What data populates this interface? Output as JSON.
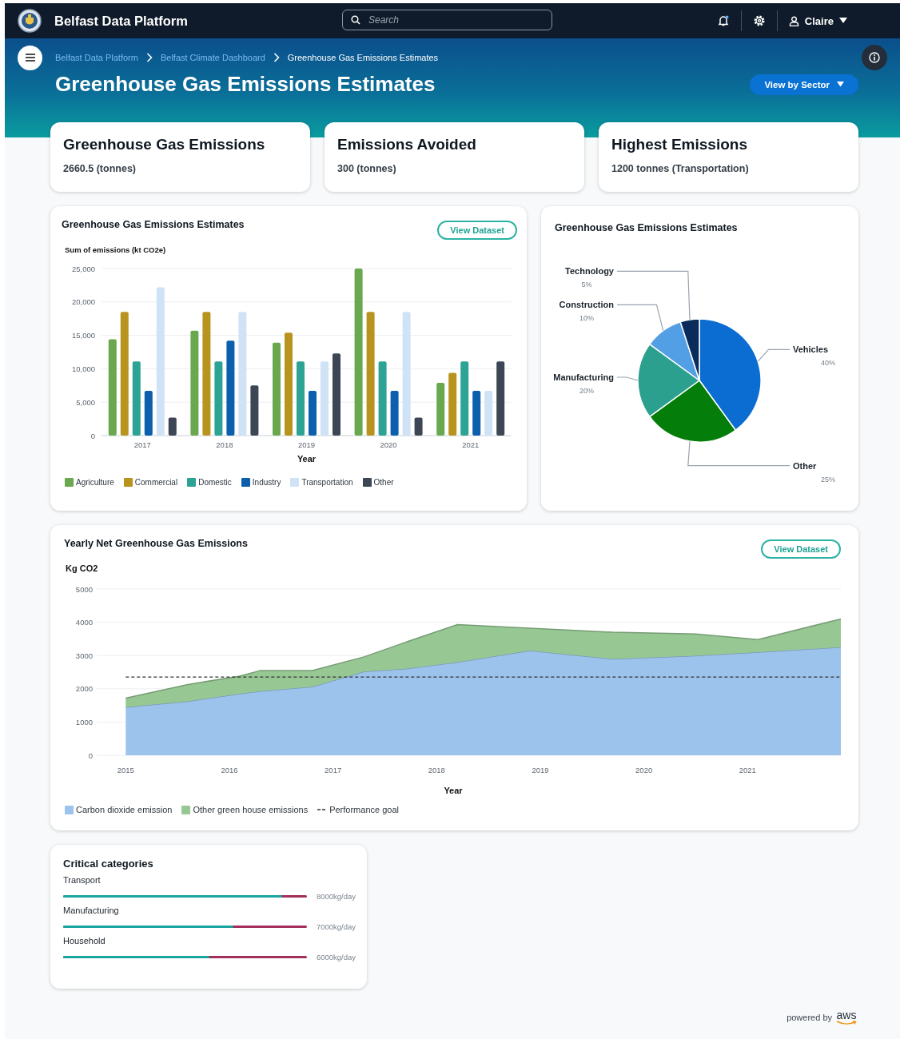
{
  "navbar": {
    "title": "Belfast Data Platform",
    "search": {
      "placeholder": "Search"
    },
    "user": "Claire"
  },
  "breadcrumbs": [
    {
      "label": "Belfast Data Platform",
      "current": false
    },
    {
      "label": "Belfast Climate Dashboard",
      "current": false
    },
    {
      "label": "Greenhouse Gas Emissions Estimates",
      "current": true
    }
  ],
  "page_title": "Greenhouse Gas Emissions Estimates",
  "view_button": "View by Sector",
  "summary_cards": [
    {
      "title": "Greenhouse Gas Emissions",
      "value": "2660.5 (tonnes)"
    },
    {
      "title": "Emissions Avoided",
      "value": "300 (tonnes)"
    },
    {
      "title": "Highest Emissions",
      "value": "1200 tonnes (Transportation)"
    }
  ],
  "bar_panel": {
    "title": "Greenhouse Gas Emissions Estimates",
    "button": "View Dataset",
    "chart_data": {
      "type": "bar",
      "grid": true,
      "ylabel": "Sum of emissions (kt CO2e)",
      "xlabel": "Year",
      "categories": [
        "2017",
        "2018",
        "2019",
        "2020",
        "2021"
      ],
      "ylim": [
        0,
        25000
      ],
      "yticks": [
        {
          "value": 0,
          "label": "0"
        },
        {
          "value": 5000,
          "label": "5,000"
        },
        {
          "value": 10000,
          "label": "10,000"
        },
        {
          "value": 15000,
          "label": "15,000"
        },
        {
          "value": 20000,
          "label": "20,000"
        },
        {
          "value": 25000,
          "label": "25,000"
        }
      ],
      "series": [
        {
          "name": "Agriculture",
          "color": "#69a84f",
          "values": [
            14400,
            15700,
            13900,
            25000,
            7900
          ]
        },
        {
          "name": "Commercial",
          "color": "#b8941f",
          "values": [
            18500,
            18500,
            15400,
            18500,
            9400
          ]
        },
        {
          "name": "Domestic",
          "color": "#2ca394",
          "values": [
            11100,
            11100,
            11100,
            11100,
            11100
          ]
        },
        {
          "name": "Industry",
          "color": "#0b5fad",
          "values": [
            6700,
            14200,
            6700,
            6700,
            6700
          ]
        },
        {
          "name": "Transportation",
          "color": "#cfe2f6",
          "values": [
            22200,
            18500,
            11100,
            18500,
            6700
          ]
        },
        {
          "name": "Other",
          "color": "#3d4654",
          "values": [
            2700,
            7500,
            12300,
            2700,
            11100
          ]
        }
      ]
    }
  },
  "pie_panel": {
    "title": "Greenhouse Gas Emissions Estimates",
    "chart_data": {
      "type": "pie",
      "categories": [
        "Vehicles",
        "Other",
        "Manufacturing",
        "Construction",
        "Technology"
      ],
      "values": [
        40,
        25,
        20,
        10,
        5
      ],
      "colors": [
        "#0b6dd1",
        "#047d0a",
        "#2ca08e",
        "#539fe5",
        "#0a2c5c"
      ],
      "value_labels": [
        "40%",
        "25%",
        "20%",
        "10%",
        "5%"
      ]
    }
  },
  "area_panel": {
    "title": "Yearly Net Greenhouse Gas Emissions",
    "button": "View Dataset",
    "chart_data": {
      "type": "area",
      "grid": true,
      "ylabel": "Kg CO2",
      "xlabel": "Year",
      "stacked": true,
      "xlim": [
        2014.72,
        2021.9
      ],
      "ylim": [
        0,
        5000
      ],
      "xticks": [
        2015,
        2016,
        2017,
        2018,
        2019,
        2020,
        2021
      ],
      "yticks": [
        0,
        1000,
        2000,
        3000,
        4000,
        5000
      ],
      "x": [
        2015,
        2015.6,
        2016.1,
        2016.3,
        2016.8,
        2017.3,
        2017.7,
        2018.2,
        2018.9,
        2019.7,
        2020.5,
        2021.1,
        2021.9
      ],
      "series": [
        {
          "name": "Carbon dioxide emission",
          "color": "#9cc3ec",
          "values": [
            1450,
            1620,
            1850,
            1930,
            2060,
            2520,
            2600,
            2800,
            3150,
            2900,
            2990,
            3100,
            3250
          ]
        },
        {
          "name": "Other green house emissions",
          "color": "#97c894",
          "values": [
            270,
            510,
            530,
            620,
            490,
            440,
            800,
            1130,
            670,
            800,
            660,
            380,
            850
          ]
        }
      ],
      "ref_lines": [
        {
          "axis": "y",
          "value": 2350,
          "label": "Performance goal",
          "color": "#333333"
        }
      ]
    }
  },
  "critical": {
    "title": "Critical categories",
    "items": [
      {
        "name": "Transport",
        "level": 0.9,
        "reading": "8000kg/day"
      },
      {
        "name": "Manufacturing",
        "level": 0.7,
        "reading": "7000kg/day"
      },
      {
        "name": "Household",
        "level": 0.6,
        "reading": "6000kg/day"
      }
    ]
  },
  "footer": {
    "text": "powered by",
    "brand": "aws"
  }
}
